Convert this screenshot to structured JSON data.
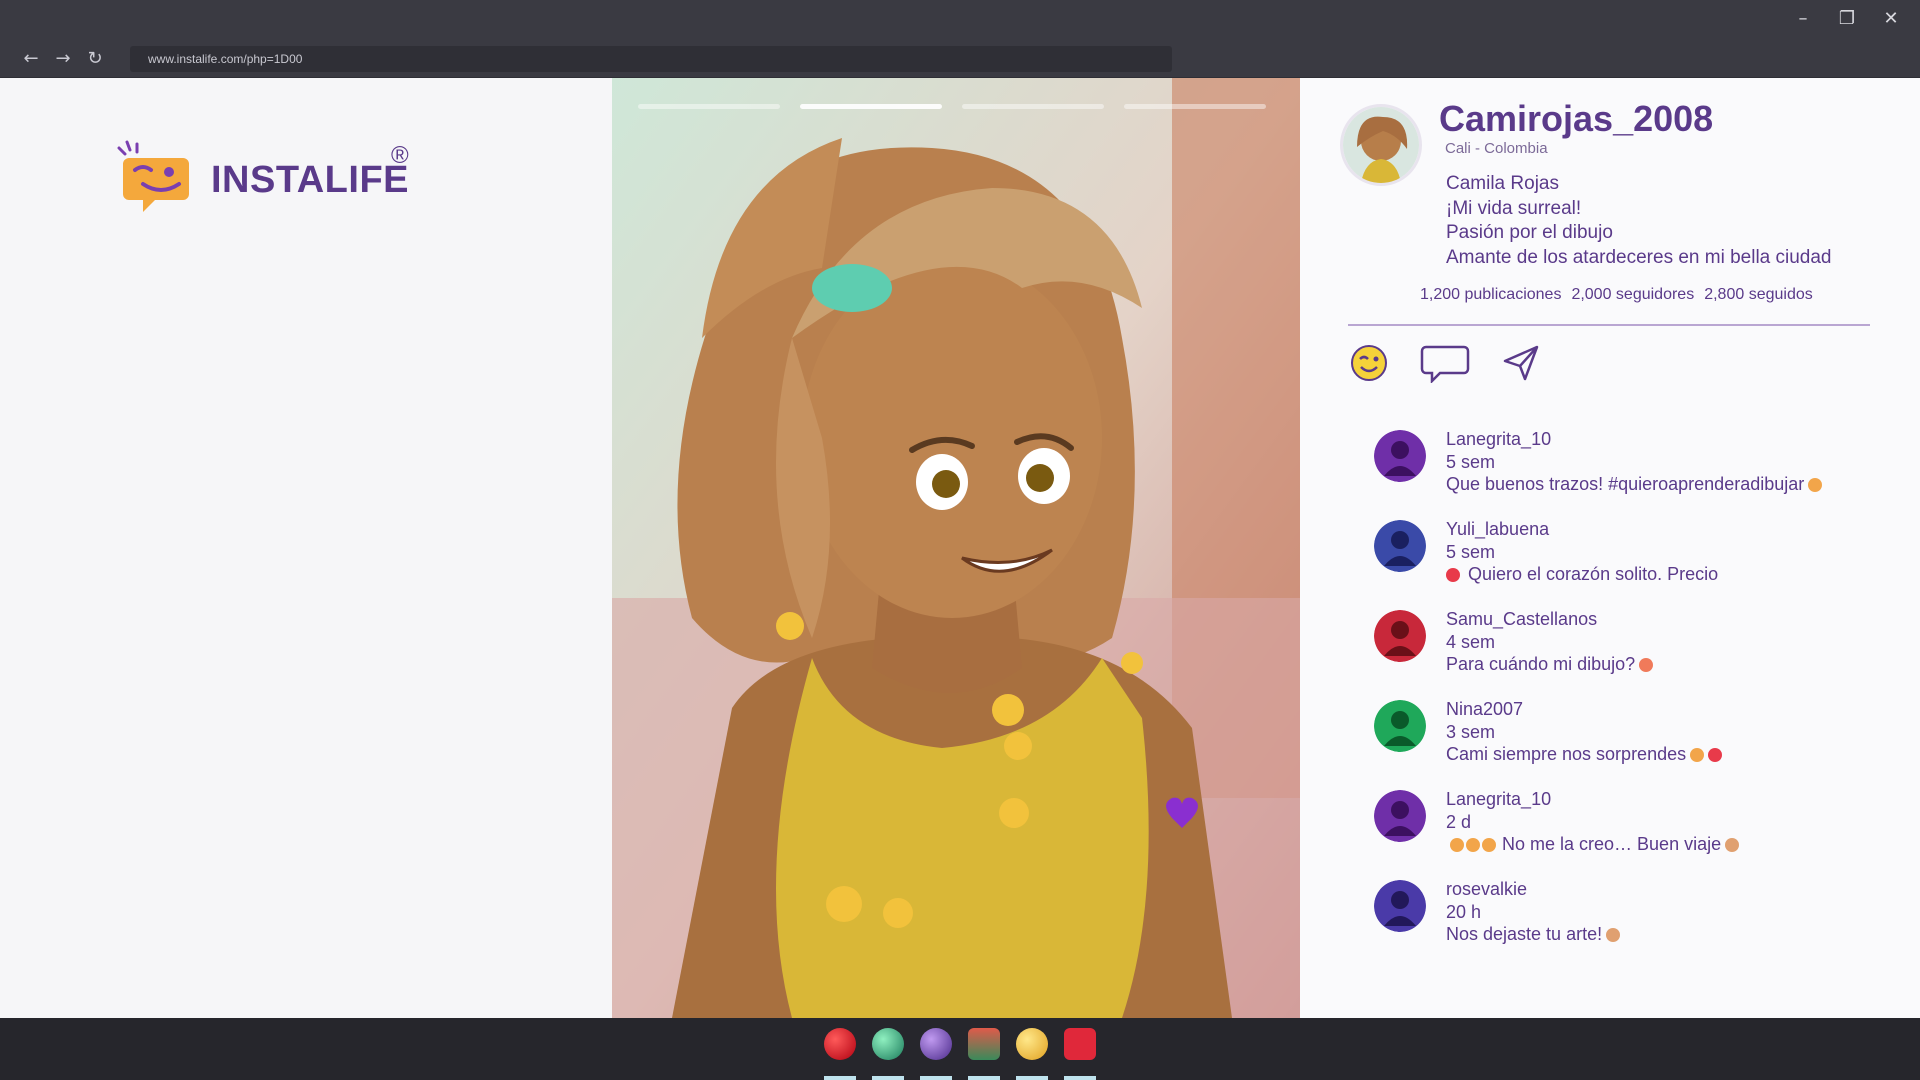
{
  "browser": {
    "url": "www.instalife.com/php=1D00"
  },
  "brand": {
    "name": "INSTALIFE",
    "registered": "®",
    "color": "#5a3a8a"
  },
  "story": {
    "segments": 4,
    "active_segment": 2
  },
  "profile": {
    "username": "Camirojas_2008",
    "location": "Cali - Colombia",
    "bio": [
      "Camila Rojas",
      "¡Mi vida surreal!",
      "Pasión por el dibujo",
      "Amante de los atardeceres en mi bella ciudad"
    ],
    "stats": {
      "posts": "1,200 publicaciones",
      "followers": "2,000 seguidores",
      "following": "2,800 seguidos"
    },
    "actions": [
      "smile-emoji-icon",
      "comment-icon",
      "send-icon"
    ]
  },
  "comments": [
    {
      "user": "Lanegrita_10",
      "time": "5 sem",
      "text": "Que buenos trazos! #quieroaprenderadibujar",
      "avatar_color": "#6f2fa8"
    },
    {
      "user": "Yuli_labuena",
      "time": "5 sem",
      "text": "Quiero el corazón solito. Precio",
      "avatar_color": "#3a4aa8"
    },
    {
      "user": "Samu_Castellanos",
      "time": "4 sem",
      "text": "Para cuándo mi dibujo?",
      "avatar_color": "#c8283a"
    },
    {
      "user": "Nina2007",
      "time": "3 sem",
      "text": "Cami siempre nos sorprendes",
      "avatar_color": "#1fa85a"
    },
    {
      "user": "Lanegrita_10",
      "time": "2 d",
      "text": "No me la creo… Buen viaje",
      "avatar_color": "#6f2fa8"
    },
    {
      "user": "rosevalkie",
      "time": "20 h",
      "text": "Nos dejaste tu arte!",
      "avatar_color": "#4a3aa8"
    }
  ],
  "taskbar": {
    "apps": [
      "red-app-icon",
      "globe-app-icon",
      "purple-app-icon",
      "photo-app-icon",
      "clock-app-icon",
      "mail-app-icon"
    ]
  }
}
